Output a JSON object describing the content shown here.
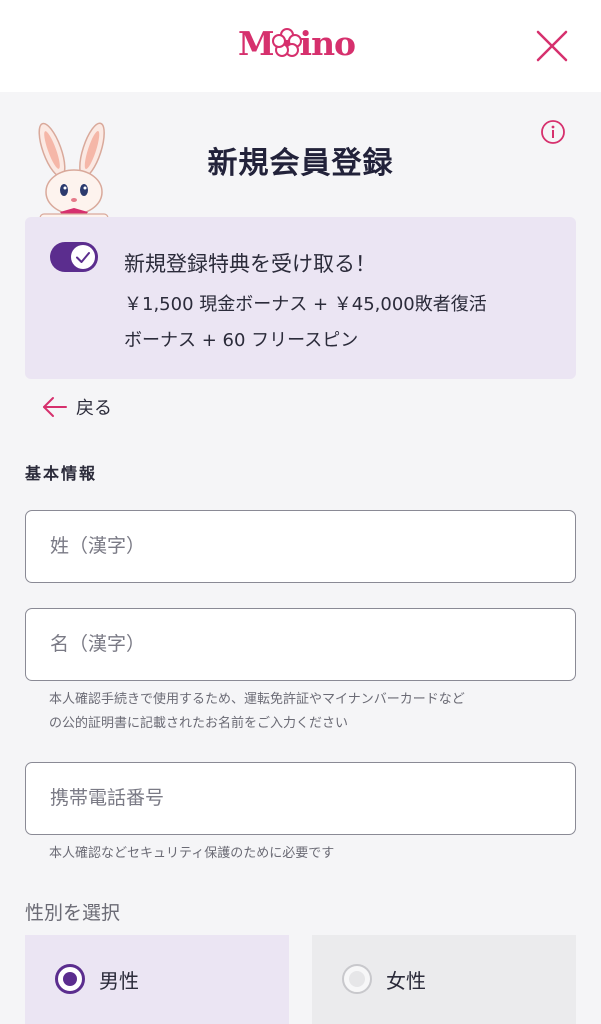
{
  "header": {
    "logo_text": "Moino",
    "logo_color": "#d6306d",
    "close_icon": "close-icon"
  },
  "page": {
    "title": "新規会員登録",
    "info_icon": "info-icon"
  },
  "bonus": {
    "toggle_on": true,
    "title": "新規登録特典を受け取る！",
    "line1": "￥1,500 現金ボーナス + ￥45,000敗者復活",
    "line2": "ボーナス + 60 フリースピン"
  },
  "back": {
    "label": "戻る"
  },
  "basic_info": {
    "section_label": "基本情報",
    "last_name_placeholder": "姓（漢字）",
    "first_name_placeholder": "名（漢字）",
    "name_hint_line1": "本人確認手続きで使用するため、運転免許証やマイナンバーカードなど",
    "name_hint_line2": "の公的証明書に記載されたお名前をご入力ください",
    "phone_placeholder": "携帯電話番号",
    "phone_hint": "本人確認などセキュリティ保護のために必要です"
  },
  "gender": {
    "label": "性別を選択",
    "male": "男性",
    "female": "女性",
    "selected": "男性"
  },
  "colors": {
    "accent": "#5b2d8e",
    "brand_pink": "#d6306d",
    "bonus_bg": "#ebe5f3"
  }
}
